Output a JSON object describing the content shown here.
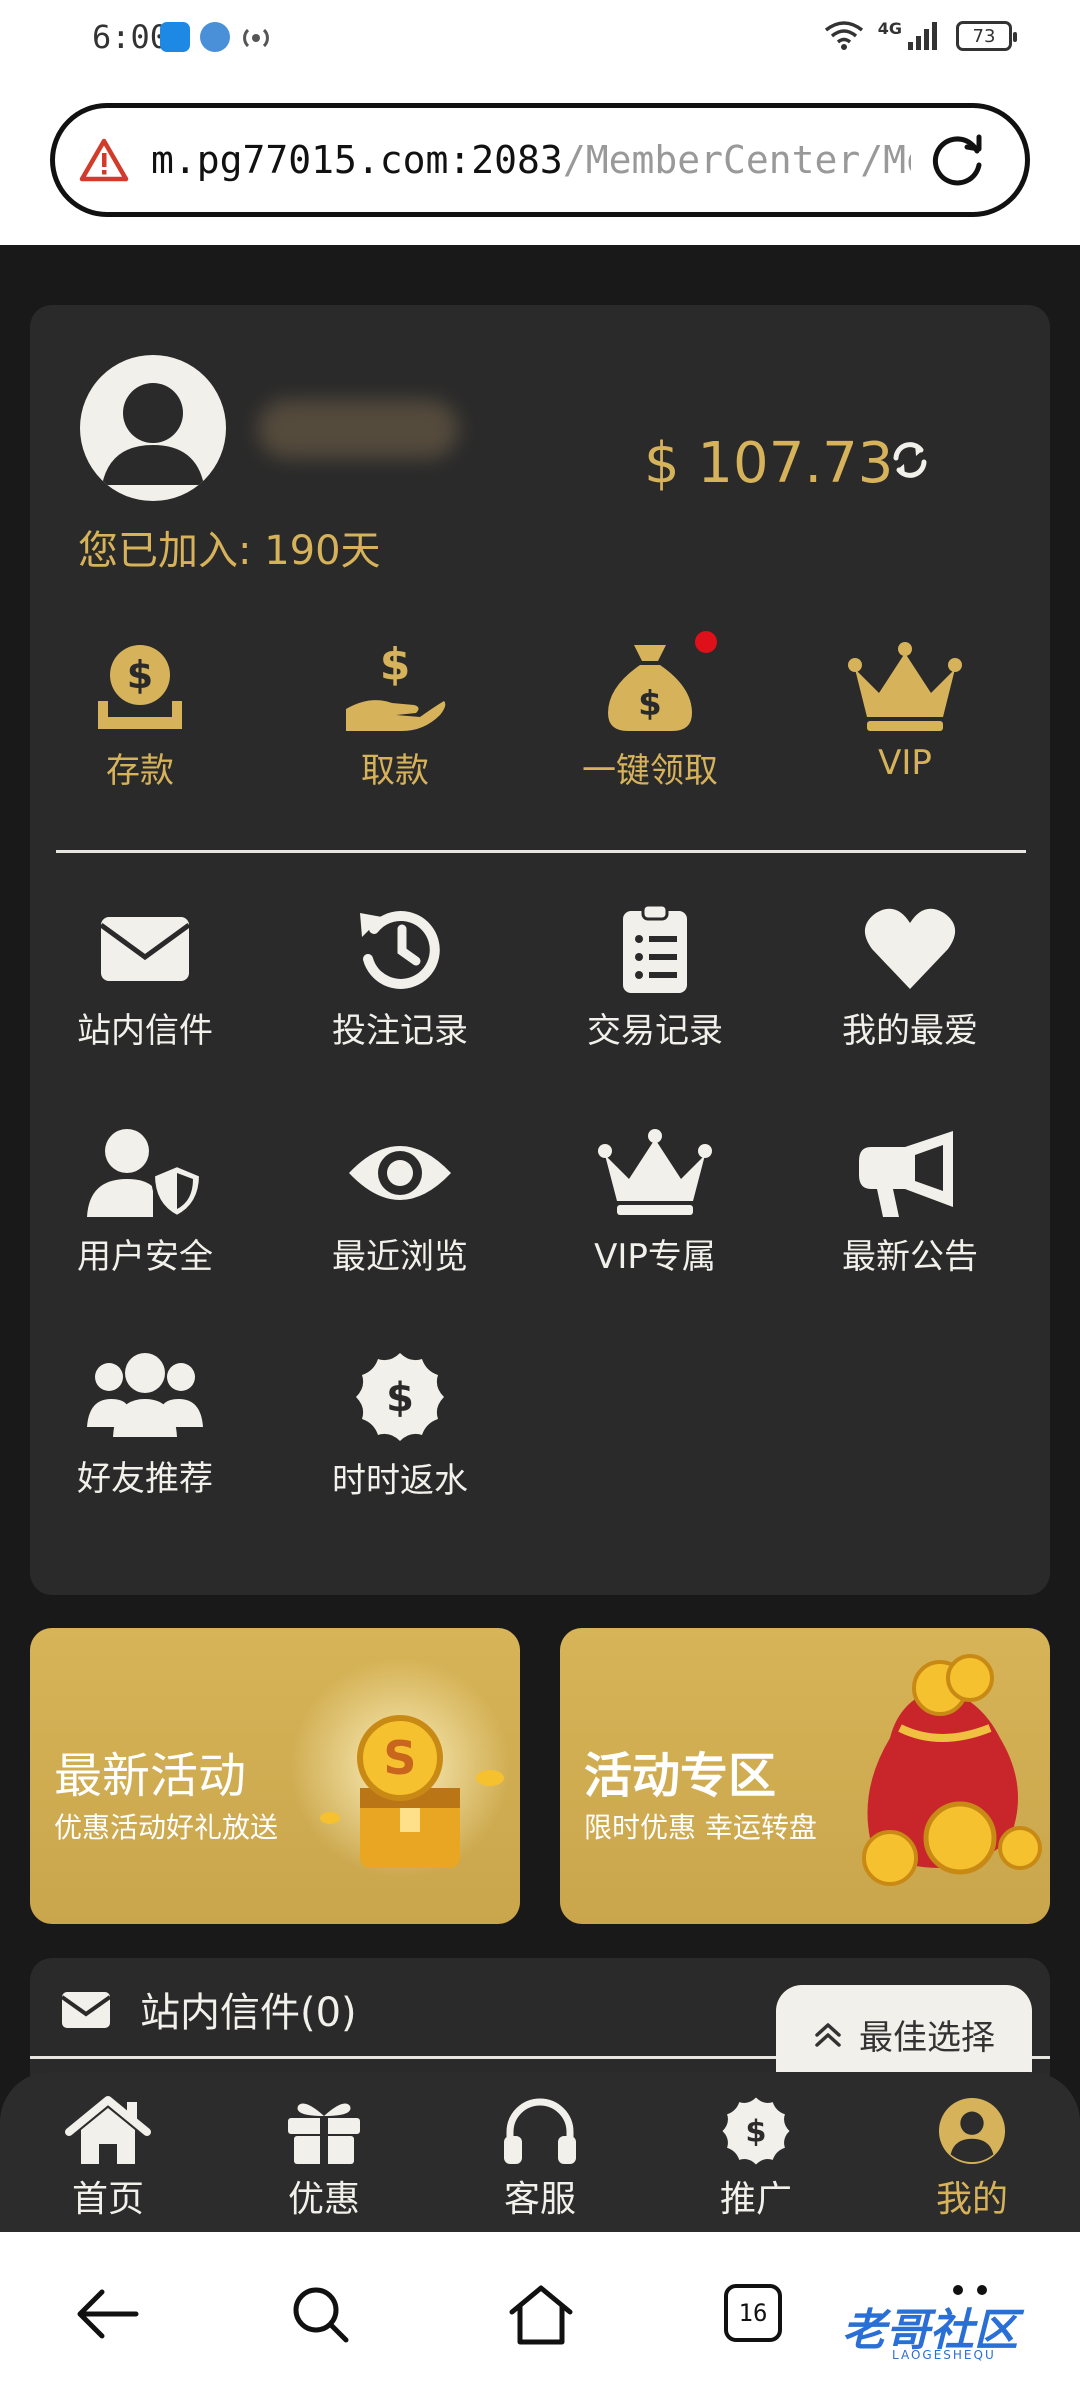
{
  "status_bar": {
    "time": "6:00",
    "network": "4G",
    "battery": "73"
  },
  "browser": {
    "url_host": "m.pg77015.com:2083",
    "url_path": "/MemberCenter/Mo"
  },
  "profile": {
    "joined": "您已加入: 190天",
    "balance": "$ 107.73"
  },
  "actions": [
    {
      "label": "存款",
      "icon": "deposit-icon"
    },
    {
      "label": "取款",
      "icon": "withdraw-icon"
    },
    {
      "label": "一键领取",
      "icon": "money-bag-icon"
    },
    {
      "label": "VIP",
      "icon": "crown-icon"
    }
  ],
  "menu": [
    {
      "label": "站内信件",
      "icon": "envelope-icon"
    },
    {
      "label": "投注记录",
      "icon": "history-icon"
    },
    {
      "label": "交易记录",
      "icon": "clipboard-list-icon"
    },
    {
      "label": "我的最爱",
      "icon": "heart-icon"
    },
    {
      "label": "用户安全",
      "icon": "user-shield-icon"
    },
    {
      "label": "最近浏览",
      "icon": "eye-icon"
    },
    {
      "label": "VIP专属",
      "icon": "crown-icon"
    },
    {
      "label": "最新公告",
      "icon": "megaphone-icon"
    },
    {
      "label": "好友推荐",
      "icon": "users-icon"
    },
    {
      "label": "时时返水",
      "icon": "dollar-badge-icon"
    }
  ],
  "banners": [
    {
      "title": "最新活动",
      "subtitle": "优惠活动好礼放送"
    },
    {
      "title": "活动专区",
      "subtitle": "限时优惠 幸运转盘"
    }
  ],
  "mailbox": {
    "title": "站内信件(0)"
  },
  "best_choice": {
    "label": "最佳选择"
  },
  "tabs": [
    {
      "label": "首页",
      "icon": "home-icon"
    },
    {
      "label": "优惠",
      "icon": "gift-icon"
    },
    {
      "label": "客服",
      "icon": "headset-icon"
    },
    {
      "label": "推广",
      "icon": "dollar-badge-icon"
    },
    {
      "label": "我的",
      "icon": "user-circle-icon",
      "active": true
    }
  ],
  "system_nav": {
    "tab_count": "16",
    "watermark": "老哥社区",
    "watermark_sub": "LAOGESHEQU"
  },
  "colors": {
    "gold": "#d6b25a",
    "card": "#2a2a2a",
    "background": "#191919",
    "badge": "#e0101a"
  }
}
